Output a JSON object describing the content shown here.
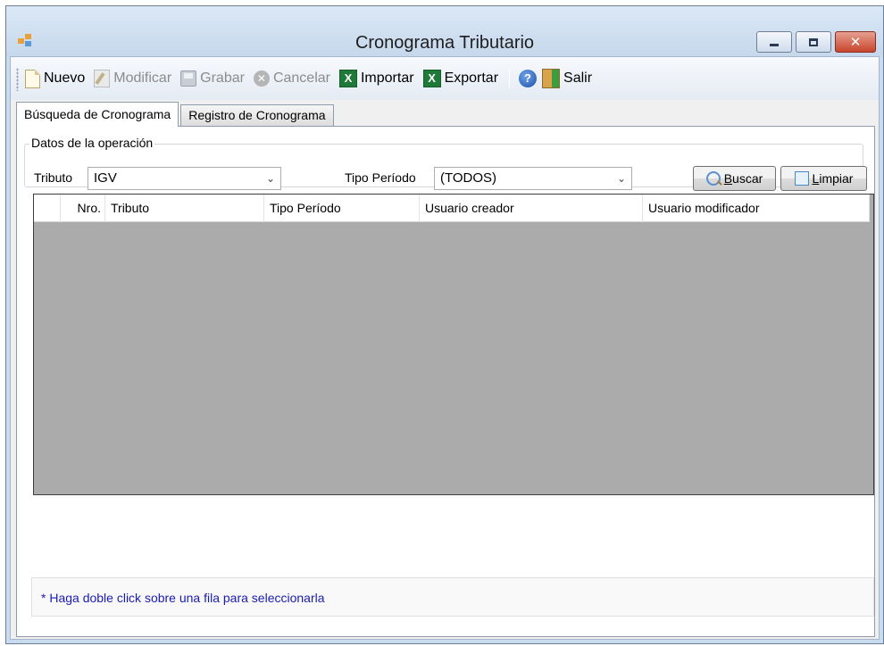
{
  "window": {
    "title": "Cronograma Tributario"
  },
  "toolbar": {
    "items": [
      {
        "label": "Nuevo",
        "icon": "new-document-icon",
        "enabled": true
      },
      {
        "label": "Modificar",
        "icon": "edit-icon",
        "enabled": false
      },
      {
        "label": "Grabar",
        "icon": "save-icon",
        "enabled": false
      },
      {
        "label": "Cancelar",
        "icon": "cancel-icon",
        "enabled": false
      },
      {
        "label": "Importar",
        "icon": "excel-icon",
        "enabled": true
      },
      {
        "label": "Exportar",
        "icon": "excel-icon",
        "enabled": true
      },
      {
        "label": "Salir",
        "icon": "exit-icon",
        "enabled": true
      }
    ],
    "help_icon": "help-icon",
    "glyphs": {
      "cancel": "✕",
      "excel": "X",
      "help": "?"
    }
  },
  "tabs": [
    {
      "label": "Búsqueda de Cronograma",
      "active": true
    },
    {
      "label": "Registro de Cronograma",
      "active": false
    }
  ],
  "search": {
    "group_title": "Datos de la operación",
    "tributo_label": "Tributo",
    "tributo_value": "IGV",
    "tipo_periodo_label": "Tipo Período",
    "tipo_periodo_value": "(TODOS)",
    "buscar_prefix": "",
    "buscar_mnemonic": "B",
    "buscar_rest": "uscar",
    "limpiar_mnemonic": "L",
    "limpiar_rest": "impiar"
  },
  "grid": {
    "columns": [
      "Nro.",
      "Tributo",
      "Tipo Período",
      "Usuario creador",
      "Usuario modificador"
    ],
    "rows": []
  },
  "footer": {
    "hint": "* Haga doble click sobre una fila para seleccionarla"
  },
  "colors": {
    "grid_background": "#ababab",
    "hint_text": "#1b1bb4",
    "window_frame": "#c9dbef"
  },
  "combo_arrow": "⌄"
}
